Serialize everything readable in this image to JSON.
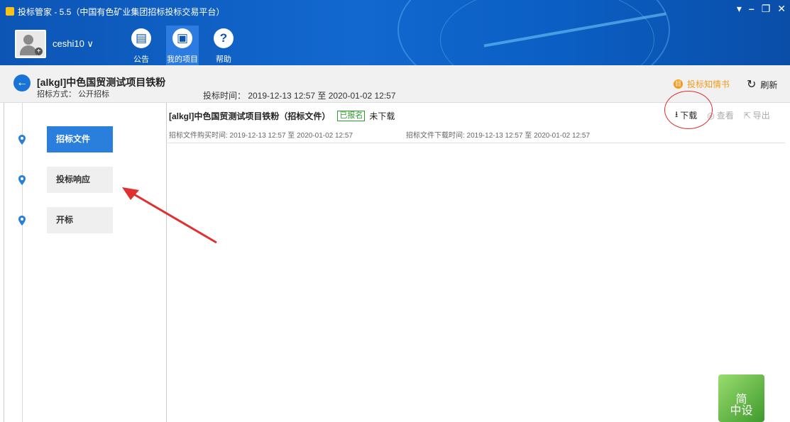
{
  "window": {
    "title": "投标管家 - 5.5（中国有色矿业集团招标投标交易平台）",
    "controls": [
      "▾",
      "–",
      "❐",
      "✕"
    ]
  },
  "user": {
    "name": "ceshi10 ∨"
  },
  "nav": [
    {
      "label": "公告",
      "icon": "announcement-icon",
      "glyph": "▤"
    },
    {
      "label": "我的项目",
      "icon": "briefcase-icon",
      "glyph": "▣"
    },
    {
      "label": "帮助",
      "icon": "help-icon",
      "glyph": "?"
    }
  ],
  "project": {
    "title": "[alkgl]中色国贸测试项目铁粉",
    "method": "招标方式：  公开招标",
    "bid_time": "投标时间：  2019-12-13 12:57 至 2020-01-02 12:57",
    "notice_link": "投标知情书",
    "refresh_label": "刷新"
  },
  "steps": [
    {
      "label": "招标文件",
      "active": true
    },
    {
      "label": "投标响应",
      "active": false
    },
    {
      "label": "开标",
      "active": false
    }
  ],
  "document": {
    "title": "[alkgl]中色国贸测试项目铁粉（招标文件）",
    "status_badge": "已报名",
    "download_status": "未下载",
    "purchase_time": "招标文件购买时间: 2019-12-13 12:57 至 2020-01-02 12:57",
    "download_time": "招标文件下载时间: 2019-12-13 12:57 至 2020-01-02 12:57"
  },
  "actions": {
    "download": "下载",
    "view": "查看",
    "export": "导出"
  },
  "corner_badge": {
    "line1": "简",
    "line2": "中设"
  },
  "colors": {
    "header": "#0c55b5",
    "active_step": "#2a7fdd",
    "accent_orange": "#f39a1b",
    "annotation_red": "#e03030"
  }
}
